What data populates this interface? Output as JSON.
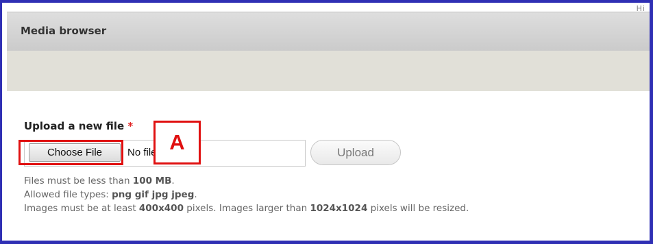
{
  "window": {
    "corner_text": "Hi"
  },
  "dialog": {
    "title": "Media browser"
  },
  "upload": {
    "label": "Upload a new file",
    "required_mark": "*",
    "choose_button": "Choose File",
    "file_status": "No file chosen",
    "upload_button": "Upload"
  },
  "help": {
    "line1_prefix": "Files must be less than ",
    "line1_value": "100 MB",
    "line1_suffix": ".",
    "line2_prefix": "Allowed file types: ",
    "line2_value": "png gif jpg jpeg",
    "line2_suffix": ".",
    "line3_prefix": "Images must be at least ",
    "line3_min": "400x400",
    "line3_mid": " pixels. Images larger than ",
    "line3_max": "1024x1024",
    "line3_suffix": " pixels will be resized."
  },
  "annotation": {
    "marker": "A",
    "color": "#e01010"
  },
  "colors": {
    "frame": "#2f2fb4",
    "toolbar_band": "#e1e0d8",
    "required": "#e02020"
  }
}
